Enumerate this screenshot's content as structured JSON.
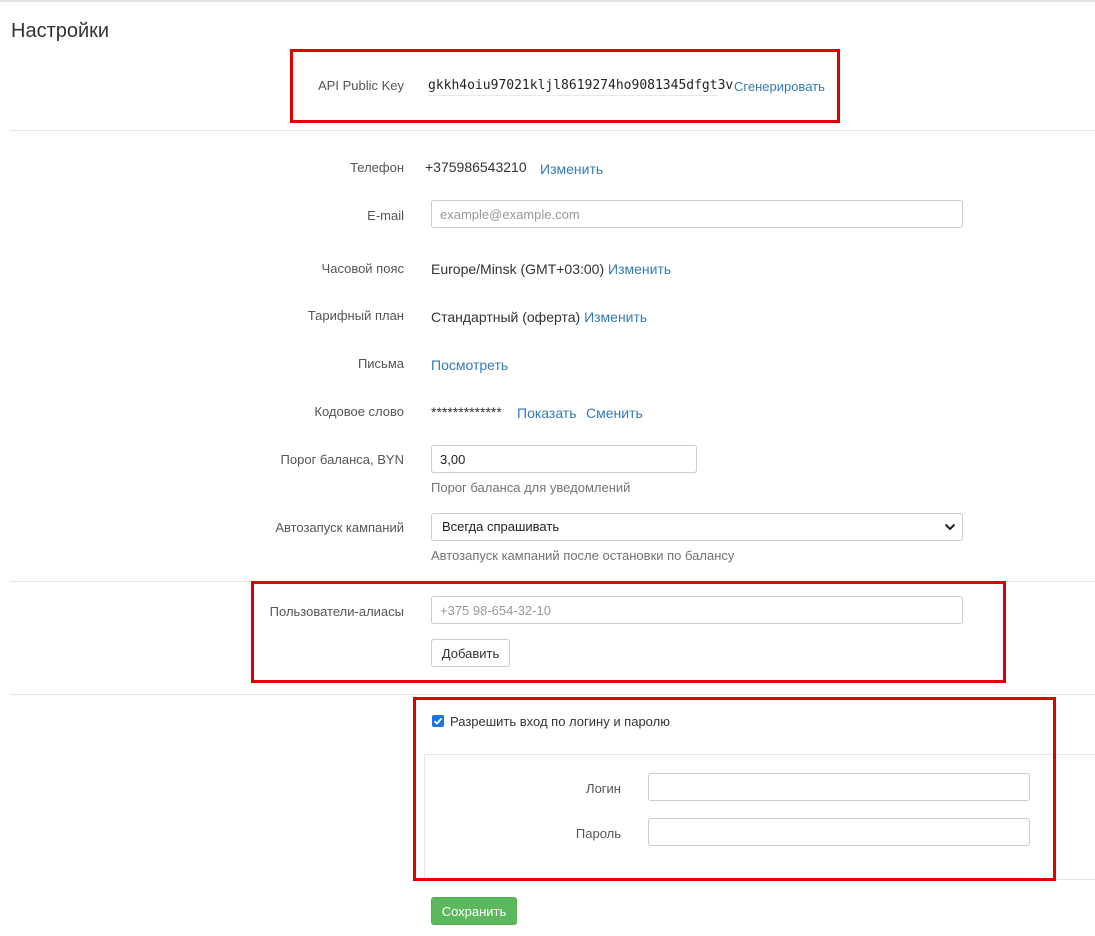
{
  "page": {
    "title": "Настройки"
  },
  "api": {
    "label": "API Public Key",
    "key": "gkkh4oiu97021kljl8619274ho9081345dfgt3v",
    "generate_label": "Сгенерировать"
  },
  "phone": {
    "label": "Телефон",
    "value": "+375986543210",
    "change_label": "Изменить"
  },
  "email": {
    "label": "E-mail",
    "placeholder": "example@example.com",
    "value": ""
  },
  "timezone": {
    "label": "Часовой пояс",
    "value": "Europe/Minsk (GMT+03:00)",
    "change_label": "Изменить"
  },
  "tariff": {
    "label": "Тарифный план",
    "value": "Стандартный (оферта)",
    "change_label": "Изменить"
  },
  "letters": {
    "label": "Письма",
    "view_label": "Посмотреть"
  },
  "codeword": {
    "label": "Кодовое слово",
    "masked": "*************",
    "show_label": "Показать",
    "change_label": "Сменить"
  },
  "balance": {
    "label": "Порог баланса, BYN",
    "value": "3,00",
    "help": "Порог баланса для уведомлений"
  },
  "autostart": {
    "label": "Автозапуск кампаний",
    "selected": "Всегда спрашивать",
    "help": "Автозапуск кампаний после остановки по балансу"
  },
  "aliases": {
    "label": "Пользователи-алиасы",
    "placeholder": "+375 98-654-32-10",
    "add_label": "Добавить"
  },
  "login": {
    "allow_label": "Разрешить вход по логину и паролю",
    "allow_checked": true,
    "login_label": "Логин",
    "password_label": "Пароль",
    "login_value": "",
    "password_value": ""
  },
  "save_label": "Сохранить",
  "colors": {
    "link": "#337ab7",
    "success": "#5cb85c",
    "highlight": "#e00000",
    "checkbox": "#1a73e8"
  }
}
